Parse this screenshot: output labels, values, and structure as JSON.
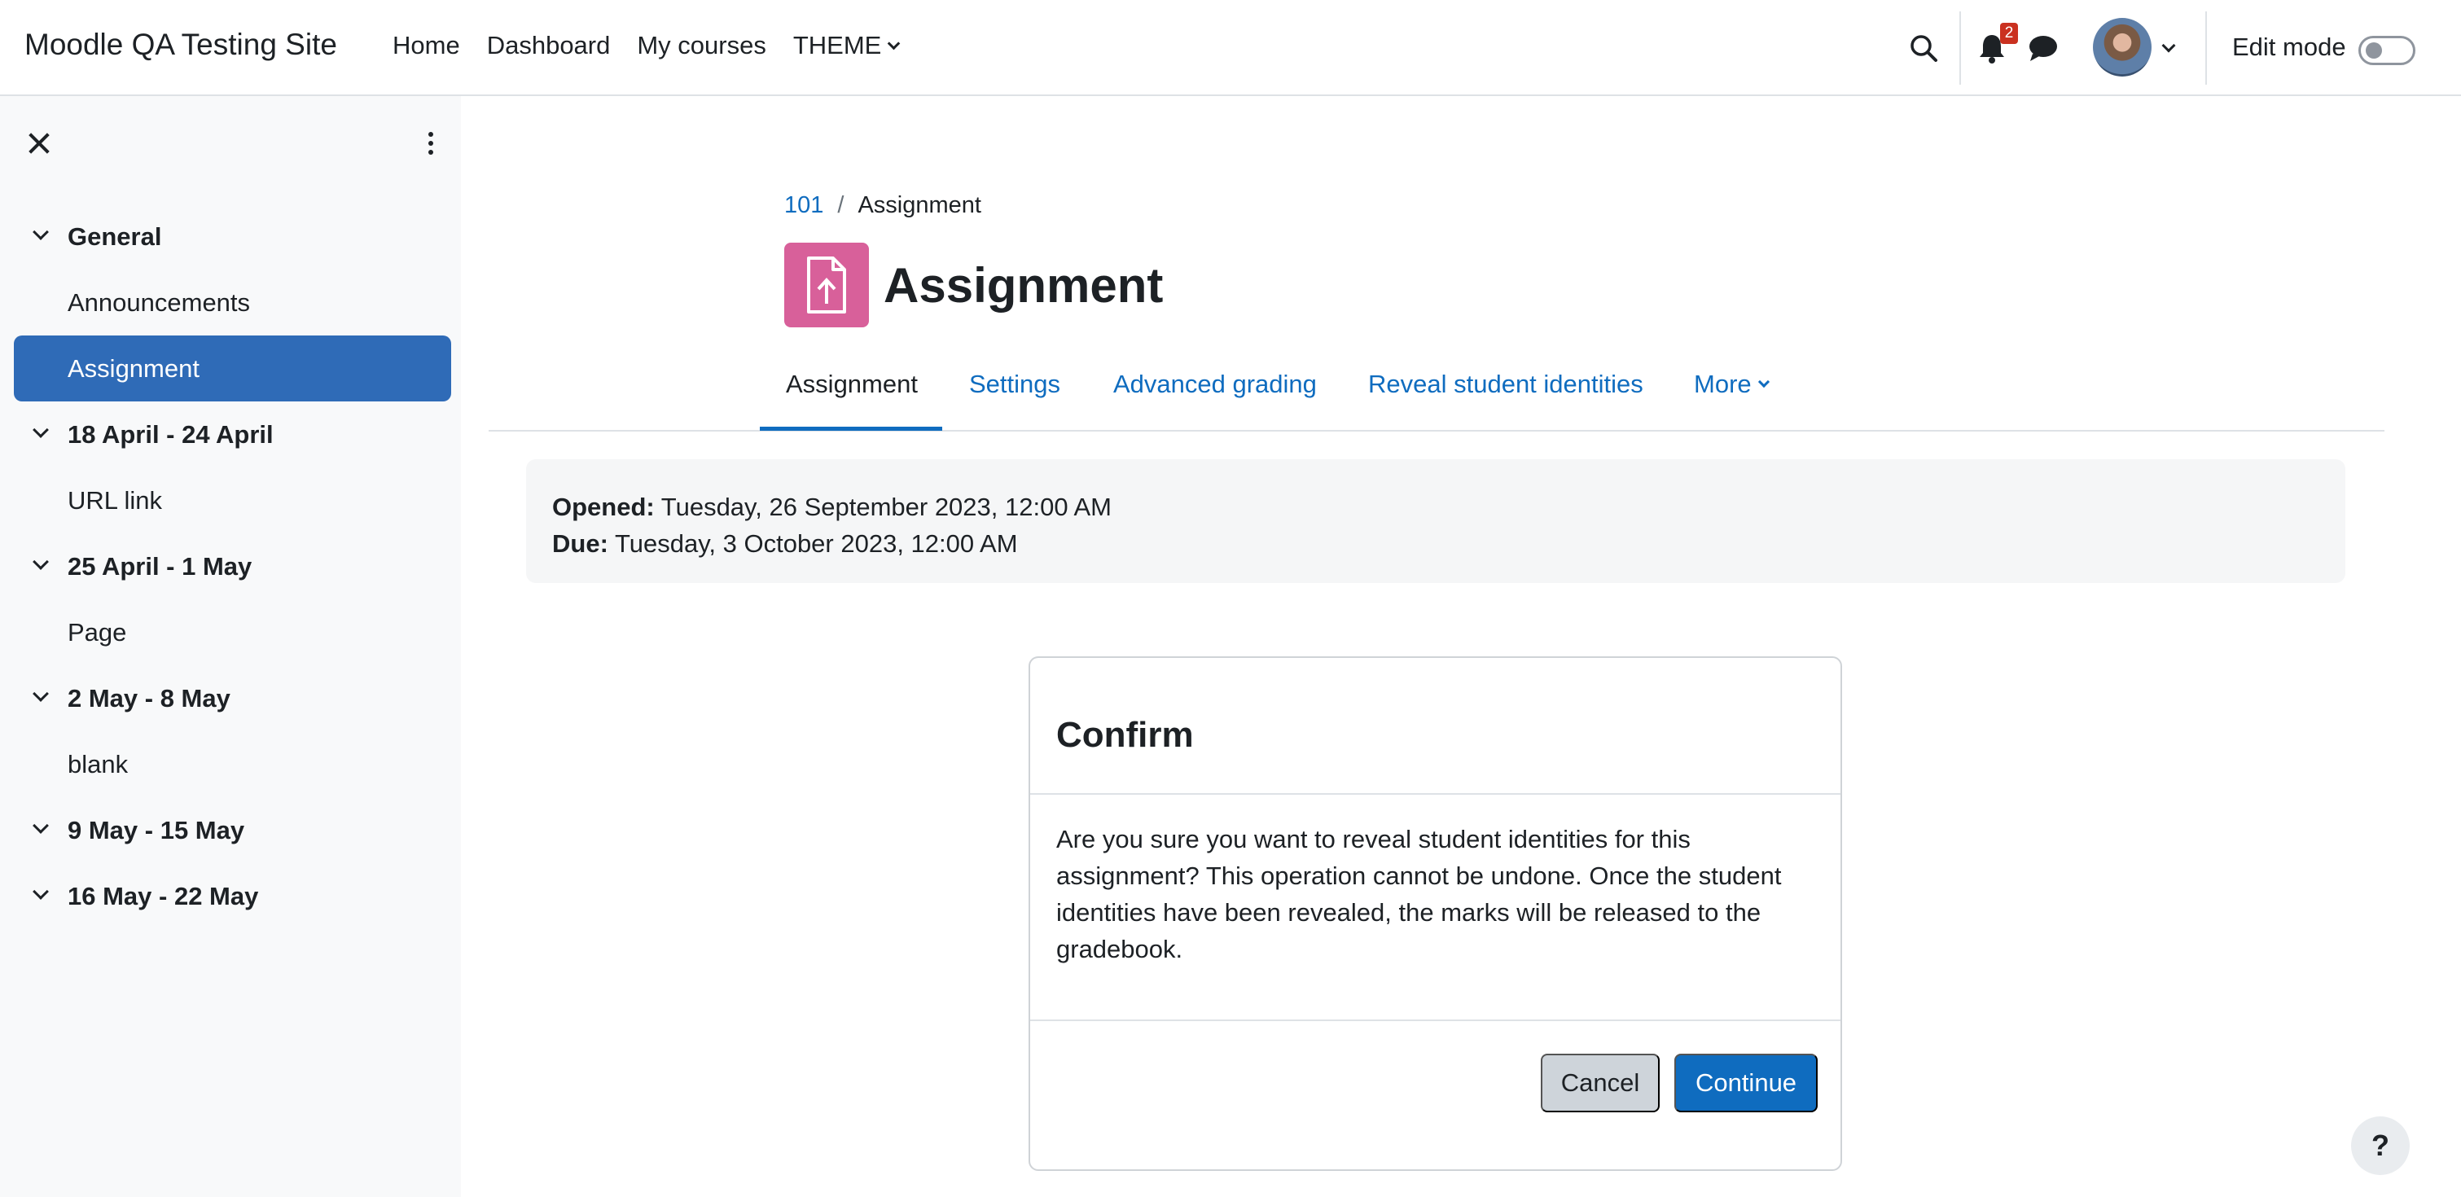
{
  "navbar": {
    "site_name": "Moodle QA Testing Site",
    "links": [
      "Home",
      "Dashboard",
      "My courses",
      "THEME"
    ],
    "notification_count": "2",
    "edit_mode_label": "Edit mode"
  },
  "sidebar": {
    "course_index": [
      {
        "type": "section",
        "label": "General"
      },
      {
        "type": "item",
        "label": "Announcements"
      },
      {
        "type": "item",
        "label": "Assignment",
        "active": true
      },
      {
        "type": "section",
        "label": "18 April - 24 April"
      },
      {
        "type": "item",
        "label": "URL link"
      },
      {
        "type": "section",
        "label": "25 April - 1 May"
      },
      {
        "type": "item",
        "label": "Page"
      },
      {
        "type": "section",
        "label": "2 May - 8 May"
      },
      {
        "type": "item",
        "label": "blank"
      },
      {
        "type": "section",
        "label": "9 May - 15 May"
      },
      {
        "type": "section",
        "label": "16 May - 22 May"
      }
    ]
  },
  "breadcrumb": {
    "course": "101",
    "separator": "/",
    "current": "Assignment"
  },
  "page": {
    "title": "Assignment",
    "icon": "assignment-upload-icon",
    "icon_color": "#d8609a"
  },
  "tabs": {
    "items": [
      "Assignment",
      "Settings",
      "Advanced grading",
      "Reveal student identities",
      "More"
    ],
    "active": "Assignment"
  },
  "dates": {
    "opened_label": "Opened:",
    "opened_value": "Tuesday, 26 September 2023, 12:00 AM",
    "due_label": "Due:",
    "due_value": "Tuesday, 3 October 2023, 12:00 AM"
  },
  "modal": {
    "title": "Confirm",
    "body": "Are you sure you want to reveal student identities for this assignment? This operation cannot be undone. Once the student identities have been revealed, the marks will be released to the gradebook.",
    "cancel_label": "Cancel",
    "continue_label": "Continue"
  },
  "help": {
    "label": "?"
  },
  "colors": {
    "primary": "#0f6cbf",
    "active_bg": "#2f6bb7",
    "sidebar_bg": "#f8f9fa",
    "badge": "#ca3120"
  }
}
